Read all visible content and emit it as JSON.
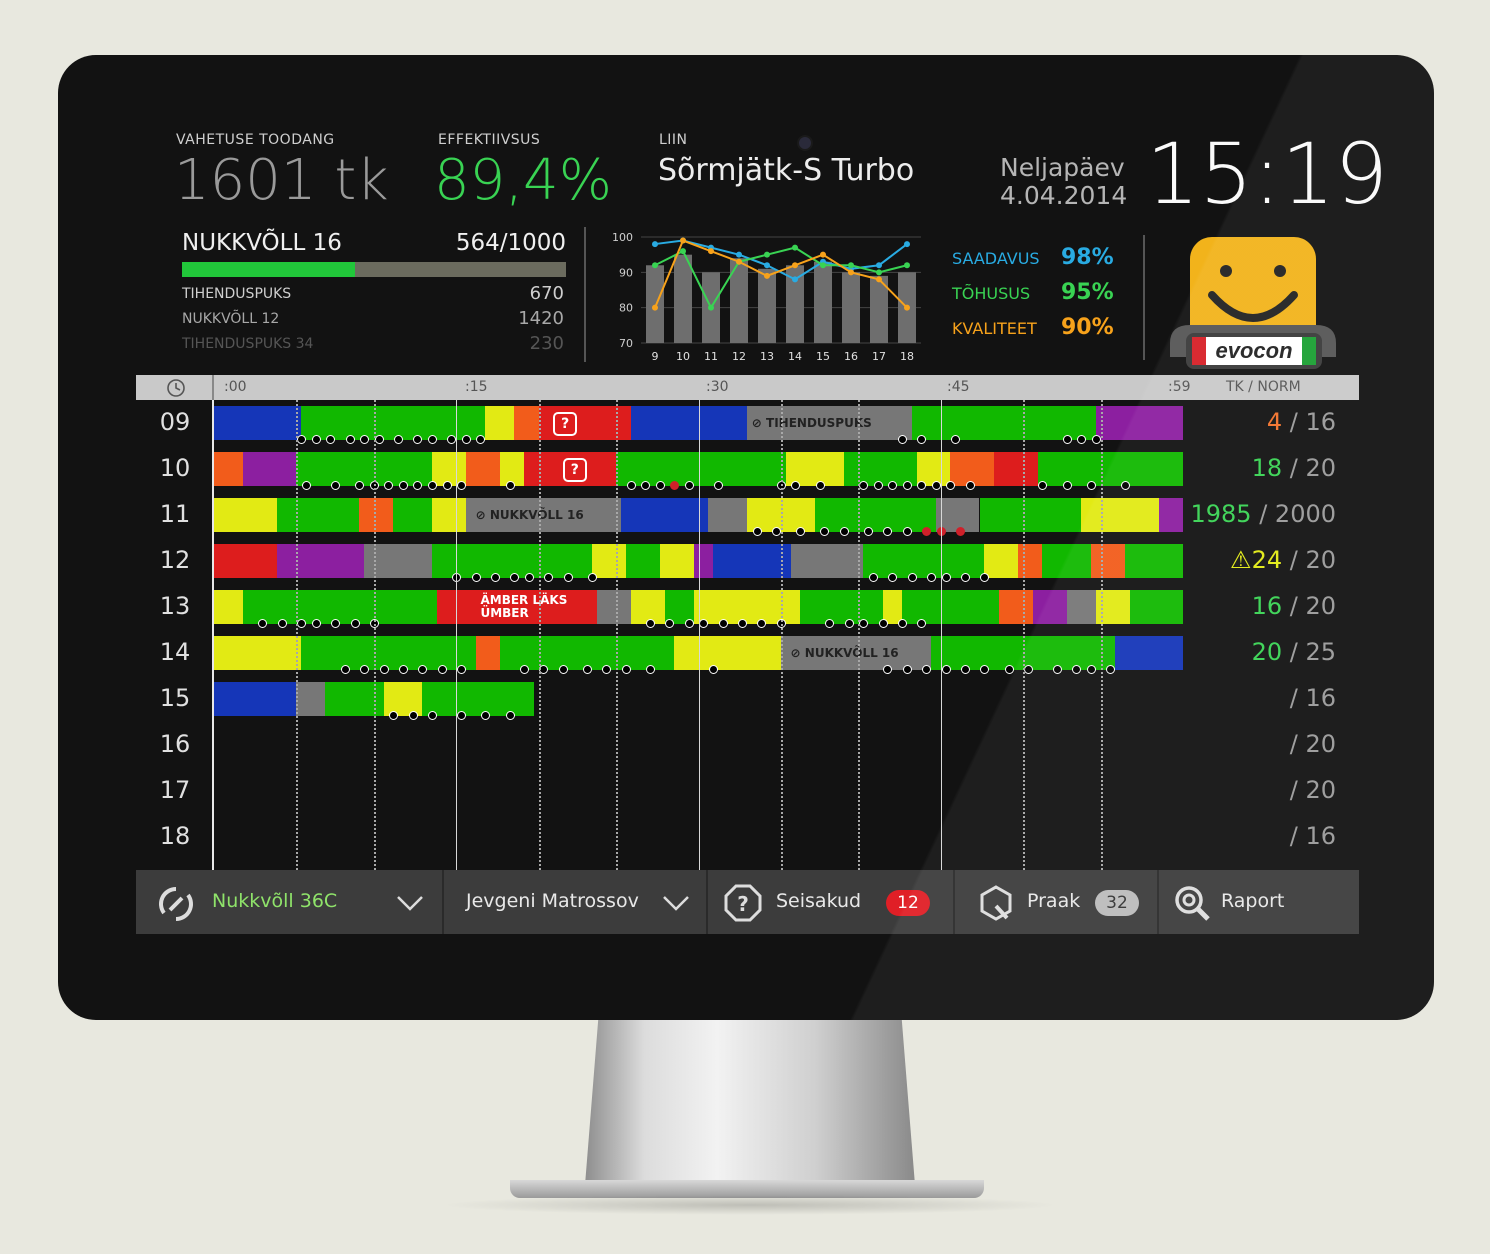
{
  "header": {
    "shift_output_label": "VAHETUSE TOODANG",
    "shift_output_value": "1601 tk",
    "efficiency_label": "EFFEKTIIVSUS",
    "efficiency_value": "89,4%",
    "line_label": "LIIN",
    "line_name": "Sõrmjätk-S Turbo",
    "weekday": "Neljapäev",
    "date": "4.04.2014",
    "time": "15:19"
  },
  "current_product": {
    "name": "NUKKVÕLL 16",
    "progress_text": "564/1000",
    "progress_fraction": 0.564
  },
  "queue": [
    {
      "name": "TIHENDUSPUKS",
      "qty": "670"
    },
    {
      "name": "NUKKVÕLL 12",
      "qty": "1420"
    },
    {
      "name": "TIHENDUSPUKS 34",
      "qty": "230"
    }
  ],
  "chart_data": {
    "type": "bar",
    "categories": [
      "9",
      "10",
      "11",
      "12",
      "13",
      "14",
      "15",
      "16",
      "17",
      "18"
    ],
    "ylim": [
      70,
      100
    ],
    "y_ticks": [
      "100",
      "90",
      "80",
      "70"
    ],
    "series": [
      {
        "name": "bars",
        "values": [
          92,
          95,
          90,
          94,
          91,
          92,
          93,
          90,
          89,
          90
        ]
      },
      {
        "name": "SAADAVUS",
        "values": [
          98,
          99,
          97,
          95,
          92,
          88,
          93,
          91,
          92,
          98
        ],
        "color": "#29abe2"
      },
      {
        "name": "TÕHUSUS",
        "values": [
          92,
          96,
          80,
          93,
          95,
          97,
          92,
          92,
          90,
          92
        ],
        "color": "#39d353"
      },
      {
        "name": "KVALITEET",
        "values": [
          80,
          99,
          96,
          93,
          89,
          92,
          95,
          90,
          88,
          80
        ],
        "color": "#f7a21b"
      }
    ]
  },
  "stats": [
    {
      "label": "SAADAVUS",
      "value": "98%",
      "color": "#29abe2"
    },
    {
      "label": "TÕHUSUS",
      "value": "95%",
      "color": "#39d353"
    },
    {
      "label": "KVALITEET",
      "value": "90%",
      "color": "#f7a21b"
    }
  ],
  "logo_text": "evocon",
  "timeline": {
    "clock_icon": "clock-icon",
    "minute_labels": [
      ":00",
      ":15",
      ":30",
      ":45",
      ":59"
    ],
    "tk_norm_header": "TK / NORM",
    "colors": {
      "B": "#1536b8",
      "P": "#8c1fa0",
      "G": "#11b800",
      "Y": "#e2ea14",
      "O": "#f25c1b",
      "R": "#dd1d1d",
      "S": "#777777"
    },
    "rows": [
      {
        "hour": "09",
        "tk": "4",
        "norm": "/ 16",
        "tk_color": "#f2722b",
        "segments": [
          [
            "B",
            0,
            1.8
          ],
          [
            "G",
            1.8,
            5.6
          ],
          [
            "Y",
            5.6,
            6.2
          ],
          [
            "O",
            6.2,
            6.7
          ],
          [
            "R",
            6.7,
            8.6
          ],
          [
            "B",
            8.6,
            11.0
          ],
          [
            "S",
            11.0,
            14.4
          ],
          [
            "G",
            14.4,
            18.2
          ],
          [
            "P",
            18.2,
            20.0
          ]
        ],
        "dots": [
          1.8,
          2.1,
          2.4,
          2.8,
          3.1,
          3.4,
          3.8,
          4.2,
          4.5,
          4.9,
          5.2,
          5.5,
          14.2,
          14.6,
          15.3,
          17.6,
          17.9,
          18.2
        ],
        "red_dots": [],
        "tags": [
          {
            "text": "TIHENDUSPUKS",
            "at": 11.1
          }
        ],
        "question_at": 7.0
      },
      {
        "hour": "10",
        "tk": "18",
        "norm": "/ 20",
        "tk_color": "#39d353",
        "segments": [
          [
            "O",
            0,
            0.6
          ],
          [
            "P",
            0.6,
            1.7
          ],
          [
            "G",
            1.7,
            4.5
          ],
          [
            "Y",
            4.5,
            5.2
          ],
          [
            "O",
            5.2,
            5.9
          ],
          [
            "Y",
            5.9,
            6.4
          ],
          [
            "R",
            6.4,
            8.3
          ],
          [
            "G",
            8.3,
            11.8
          ],
          [
            "Y",
            11.8,
            13.0
          ],
          [
            "G",
            13.0,
            14.5
          ],
          [
            "Y",
            14.5,
            15.2
          ],
          [
            "O",
            15.2,
            16.1
          ],
          [
            "R",
            16.1,
            17.0
          ],
          [
            "G",
            17.0,
            20.0
          ]
        ],
        "dots": [
          1.9,
          2.5,
          3.0,
          3.3,
          3.6,
          3.9,
          4.2,
          4.5,
          4.8,
          5.1,
          6.1,
          8.6,
          8.9,
          9.2,
          9.8,
          10.4,
          11.7,
          12.0,
          12.5,
          13.4,
          13.7,
          14.0,
          14.3,
          14.6,
          14.9,
          15.2,
          15.6,
          17.1,
          17.6,
          18.1,
          18.8
        ],
        "red_dots": [
          9.5
        ],
        "tags": [],
        "question_at": 7.2
      },
      {
        "hour": "11",
        "tk": "1985",
        "norm": "/ 2000",
        "tk_color": "#39d353",
        "segments": [
          [
            "Y",
            0,
            1.3
          ],
          [
            "G",
            1.3,
            3.0
          ],
          [
            "O",
            3.0,
            3.7
          ],
          [
            "G",
            3.7,
            4.5
          ],
          [
            "Y",
            4.5,
            5.2
          ],
          [
            "S",
            5.2,
            8.4
          ],
          [
            "B",
            8.4,
            10.2
          ],
          [
            "S",
            10.2,
            11.0
          ],
          [
            "Y",
            11.0,
            12.4
          ],
          [
            "G",
            12.4,
            14.9
          ],
          [
            "S",
            14.9,
            15.8
          ],
          [
            "G",
            15.8,
            17.9
          ],
          [
            "Y",
            17.9,
            19.5
          ],
          [
            "P",
            19.5,
            20.0
          ]
        ],
        "dots": [
          11.2,
          11.6,
          12.1,
          12.6,
          13.0,
          13.5,
          13.9,
          14.3
        ],
        "red_dots": [
          14.7,
          15.0,
          15.4
        ],
        "tags": [
          {
            "text": "NUKKVÕLL 16",
            "at": 5.4
          }
        ],
        "question_at": null
      },
      {
        "hour": "12",
        "tk": "24",
        "norm": "/ 20",
        "tk_color": "#e2ea14",
        "warn": true,
        "segments": [
          [
            "R",
            0,
            1.3
          ],
          [
            "P",
            1.3,
            3.1
          ],
          [
            "S",
            3.1,
            4.5
          ],
          [
            "G",
            4.5,
            7.8
          ],
          [
            "Y",
            7.8,
            8.5
          ],
          [
            "G",
            8.5,
            9.2
          ],
          [
            "Y",
            9.2,
            9.9
          ],
          [
            "P",
            9.9,
            10.3
          ],
          [
            "B",
            10.3,
            11.9
          ],
          [
            "S",
            11.9,
            13.4
          ],
          [
            "G",
            13.4,
            15.9
          ],
          [
            "Y",
            15.9,
            16.6
          ],
          [
            "O",
            16.6,
            17.1
          ],
          [
            "G",
            17.1,
            18.1
          ],
          [
            "O",
            18.1,
            18.8
          ],
          [
            "G",
            18.8,
            20.0
          ]
        ],
        "dots": [
          5.0,
          5.4,
          5.8,
          6.2,
          6.5,
          6.9,
          7.3,
          7.8,
          13.6,
          14.0,
          14.4,
          14.8,
          15.1,
          15.5,
          15.9
        ],
        "red_dots": [],
        "tags": [],
        "question_at": null
      },
      {
        "hour": "13",
        "tk": "16",
        "norm": "/ 20",
        "tk_color": "#39d353",
        "segments": [
          [
            "Y",
            0,
            0.6
          ],
          [
            "G",
            0.6,
            4.6
          ],
          [
            "R",
            4.6,
            7.9
          ],
          [
            "S",
            7.9,
            8.6
          ],
          [
            "Y",
            8.6,
            9.3
          ],
          [
            "G",
            9.3,
            9.9
          ],
          [
            "Y",
            9.9,
            12.1
          ],
          [
            "G",
            12.1,
            13.8
          ],
          [
            "Y",
            13.8,
            14.2
          ],
          [
            "G",
            14.2,
            16.2
          ],
          [
            "O",
            16.2,
            16.9
          ],
          [
            "P",
            16.9,
            17.6
          ],
          [
            "S",
            17.6,
            18.2
          ],
          [
            "Y",
            18.2,
            18.9
          ],
          [
            "G",
            18.9,
            20.0
          ]
        ],
        "dots": [
          1.0,
          1.4,
          1.8,
          2.1,
          2.5,
          2.9,
          3.3,
          9.0,
          9.4,
          9.8,
          10.1,
          10.5,
          10.9,
          11.3,
          11.7,
          12.7,
          13.1,
          13.4,
          13.8,
          14.2,
          14.6
        ],
        "red_dots": [],
        "tags": [
          {
            "text": "ÄMBER LÄKS\nÜMBER",
            "at": 5.5,
            "red": true
          }
        ],
        "question_at": null
      },
      {
        "hour": "14",
        "tk": "20",
        "norm": "/ 25",
        "tk_color": "#39d353",
        "segments": [
          [
            "Y",
            0,
            1.8
          ],
          [
            "G",
            1.8,
            5.4
          ],
          [
            "O",
            5.4,
            5.9
          ],
          [
            "G",
            5.9,
            9.5
          ],
          [
            "Y",
            9.5,
            11.7
          ],
          [
            "S",
            11.7,
            14.8
          ],
          [
            "G",
            14.8,
            18.6
          ],
          [
            "B",
            18.6,
            20.0
          ]
        ],
        "dots": [
          2.7,
          3.1,
          3.5,
          3.9,
          4.3,
          4.7,
          5.1,
          6.4,
          6.8,
          7.2,
          7.7,
          8.1,
          8.5,
          9.0,
          10.3,
          13.9,
          14.3,
          14.7,
          15.1,
          15.5,
          15.9,
          16.4,
          16.8,
          17.4,
          17.8,
          18.1,
          18.5
        ],
        "red_dots": [],
        "tags": [
          {
            "text": "NUKKVÕLL 16",
            "at": 11.9
          }
        ],
        "question_at": null
      },
      {
        "hour": "15",
        "tk": "",
        "norm": "/ 16",
        "tk_color": "#39d353",
        "segments": [
          [
            "B",
            0,
            1.7
          ],
          [
            "S",
            1.7,
            2.3
          ],
          [
            "G",
            2.3,
            3.5
          ],
          [
            "Y",
            3.5,
            4.3
          ],
          [
            "G",
            4.3,
            6.6
          ]
        ],
        "dots": [
          3.7,
          4.1,
          4.5,
          5.1,
          5.6,
          6.1
        ],
        "red_dots": [],
        "tags": [],
        "question_at": null
      },
      {
        "hour": "16",
        "tk": "",
        "norm": "/ 20",
        "tk_color": "#39d353",
        "segments": [],
        "dots": [],
        "red_dots": [],
        "tags": [],
        "question_at": null
      },
      {
        "hour": "17",
        "tk": "",
        "norm": "/ 20",
        "tk_color": "#39d353",
        "segments": [],
        "dots": [],
        "red_dots": [],
        "tags": [],
        "question_at": null
      },
      {
        "hour": "18",
        "tk": "",
        "norm": "/ 16",
        "tk_color": "#39d353",
        "segments": [],
        "dots": [],
        "red_dots": [],
        "tags": [],
        "question_at": null
      }
    ]
  },
  "bottom_bar": {
    "product_select": "Nukkvõll 36C",
    "operator_select": "Jevgeni Matrossov",
    "stops_label": "Seisakud",
    "stops_count": "12",
    "scrap_label": "Praak",
    "scrap_count": "32",
    "report_label": "Raport"
  }
}
